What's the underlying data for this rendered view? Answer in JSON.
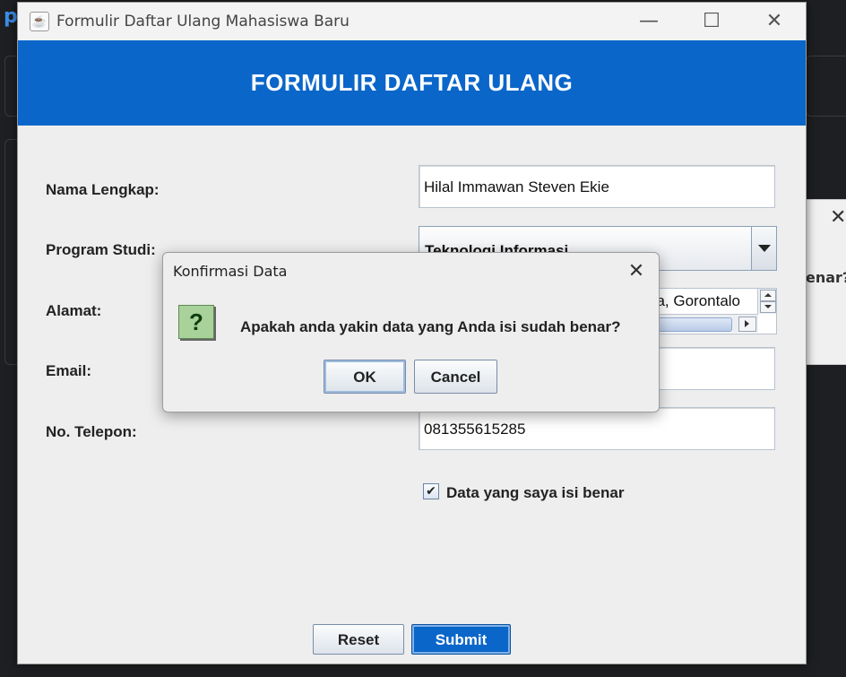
{
  "background": {
    "letter": "p",
    "dialog_fragment": "enar?"
  },
  "window": {
    "title": "Formulir Daftar Ulang Mahasiswa Baru",
    "controls": {
      "minimize": "—",
      "maximize": "☐",
      "close": "✕"
    }
  },
  "header": {
    "title": "FORMULIR DAFTAR ULANG",
    "bg_color": "#0a66c9"
  },
  "form": {
    "nama_label": "Nama Lengkap:",
    "nama_value": "Hilal Immawan Steven Ekie",
    "prodi_label": "Program Studi:",
    "prodi_value": "Teknologi Informasi",
    "alamat_label": "Alamat:",
    "alamat_value": "na, Gorontalo",
    "email_label": "Email:",
    "email_value": "",
    "telepon_label": "No. Telepon:",
    "telepon_value": "081355615285",
    "checkbox_label": "Data yang saya isi benar",
    "checkbox_checked": true,
    "checkbox_mark": "✔"
  },
  "buttons": {
    "reset": "Reset",
    "submit": "Submit"
  },
  "dialog": {
    "title": "Konfirmasi Data",
    "close": "✕",
    "icon": "question-icon",
    "icon_glyph": "?",
    "message": "Apakah anda yakin data yang Anda isi sudah benar?",
    "ok": "OK",
    "cancel": "Cancel"
  }
}
